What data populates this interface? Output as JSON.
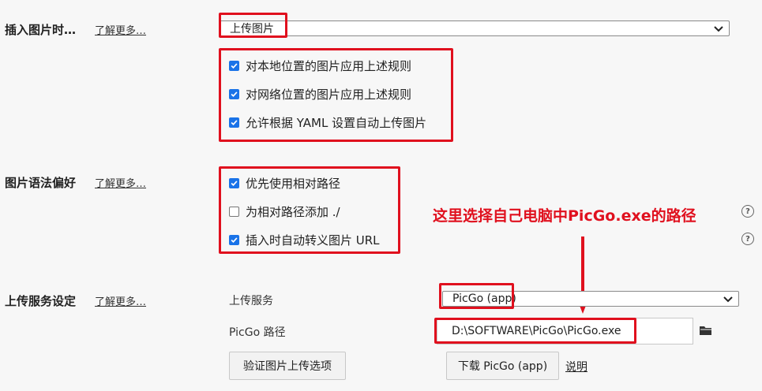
{
  "insert_image": {
    "title": "插入图片时…",
    "learn_more": "了解更多…",
    "dropdown_value": "上传图片",
    "options": [
      {
        "label": "对本地位置的图片应用上述规则",
        "checked": true
      },
      {
        "label": "对网络位置的图片应用上述规则",
        "checked": true
      },
      {
        "label": "允许根据 YAML 设置自动上传图片",
        "checked": true
      }
    ]
  },
  "image_syntax": {
    "title": "图片语法偏好",
    "learn_more": "了解更多…",
    "options": [
      {
        "label": "优先使用相对路径",
        "checked": true
      },
      {
        "label": "为相对路径添加 ./",
        "checked": false
      },
      {
        "label": "插入时自动转义图片 URL",
        "checked": true
      }
    ],
    "help_icon": "question-circle-icon"
  },
  "upload_service": {
    "title": "上传服务设定",
    "learn_more": "了解更多…",
    "service_label": "上传服务",
    "service_value": "PicGo (app)",
    "path_label": "PicGo 路径",
    "path_value": "D:\\SOFTWARE\\PicGo\\PicGo.exe",
    "folder_icon": "folder-icon",
    "verify_button": "验证图片上传选项",
    "download_button": "下载 PicGo (app)",
    "help_link": "说明"
  },
  "annotation": {
    "text": "这里选择自己电脑中PicGo.exe的路径",
    "color": "#e0101e"
  }
}
